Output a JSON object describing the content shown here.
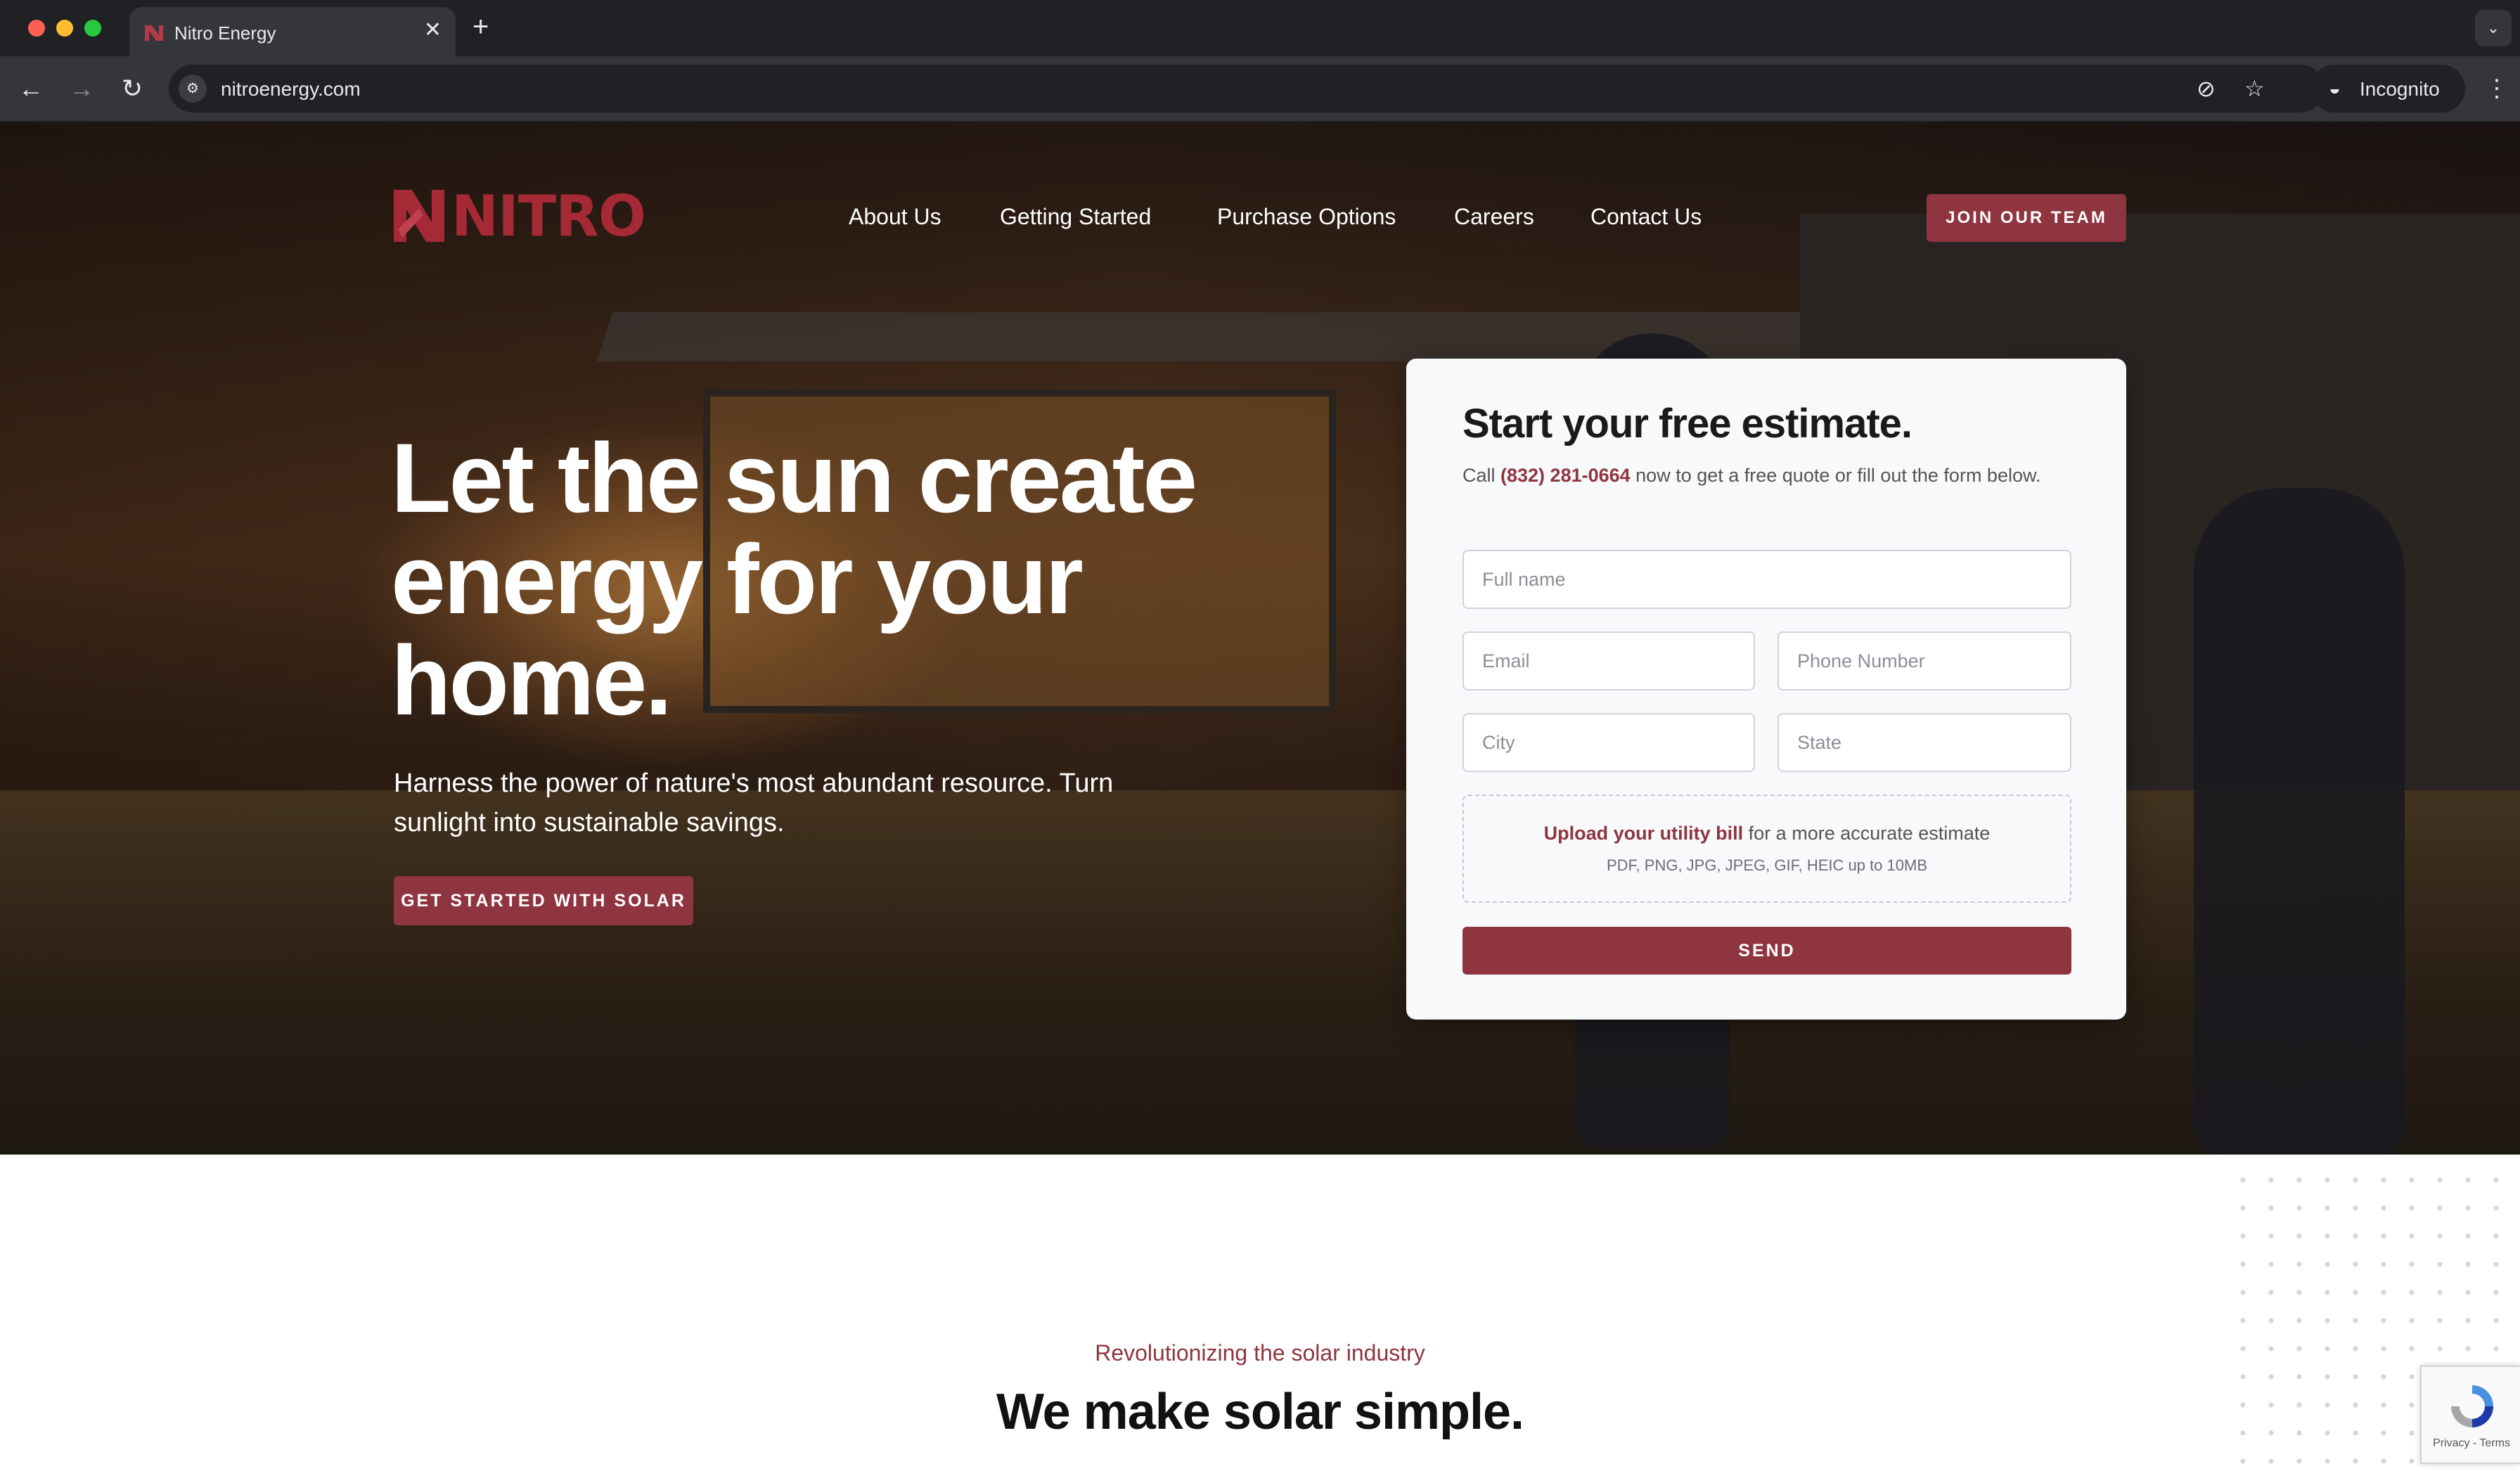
{
  "browser": {
    "tab_title": "Nitro Energy",
    "url": "nitroenergy.com",
    "incognito_label": "Incognito"
  },
  "site": {
    "logo_text": "NITRO",
    "nav": [
      "About Us",
      "Getting Started",
      "Purchase Options",
      "Careers",
      "Contact Us"
    ],
    "join_button": "JOIN OUR TEAM",
    "accent_color": "#8e3540"
  },
  "hero": {
    "headline": "Let the sun create energy for your home.",
    "subtext": "Harness the power of nature's most abundant resource. Turn sunlight into sustainable savings.",
    "cta": "GET STARTED WITH SOLAR"
  },
  "form": {
    "title": "Start your free estimate.",
    "desc_prefix": "Call ",
    "phone": "(832) 281-0664",
    "desc_suffix": " now to get a free quote or fill out the form below.",
    "fields": {
      "full_name": "Full name",
      "email": "Email",
      "phone_number": "Phone Number",
      "city": "City",
      "state": "State"
    },
    "upload_link": "Upload your utility bill",
    "upload_suffix": " for a more accurate estimate",
    "upload_formats": "PDF, PNG, JPG, JPEG, GIF, HEIC up to 10MB",
    "send": "SEND"
  },
  "section": {
    "eyebrow": "Revolutionizing the solar industry",
    "title": "We make solar simple."
  },
  "recaptcha": {
    "text": "Privacy - Terms"
  }
}
